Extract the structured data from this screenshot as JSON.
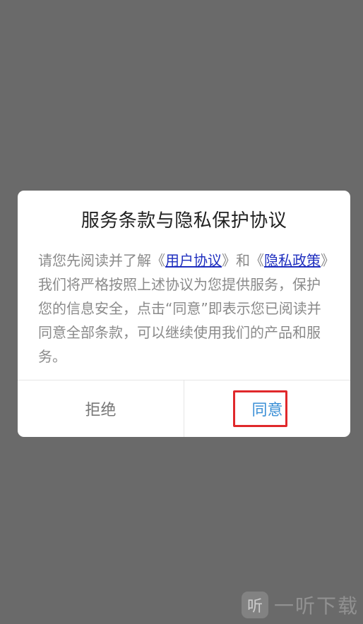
{
  "dialog": {
    "title": "服务条款与隐私保护协议",
    "body": {
      "part1": "请您先阅读并了解《",
      "link_user_agreement": "用户协议",
      "part2": "》和《",
      "link_privacy_policy": "隐私政策",
      "part3": "》我们将严格按照上述协议为您提供服务，保护您的信息安全，点击“同意”即表示您已阅读并同意全部条款，可以继续使用我们的产品和服务。"
    },
    "buttons": {
      "reject": "拒绝",
      "agree": "同意"
    }
  },
  "watermark": {
    "logo_char": "听",
    "text": "一听下载"
  },
  "colors": {
    "overlay": "#6a6a6a",
    "link": "#1f2fbf",
    "agree": "#3a8fd6",
    "highlight": "#e0282b"
  }
}
